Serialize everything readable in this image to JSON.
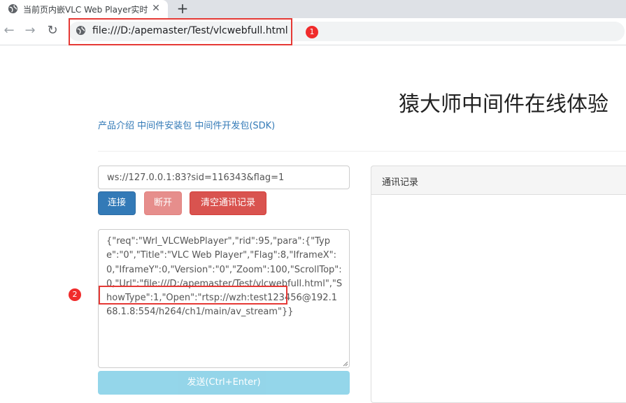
{
  "browser": {
    "tab_title": "当前页内嵌VLC Web Player实时",
    "tab_close": "✕",
    "new_tab": "+",
    "back": "←",
    "forward": "→",
    "reload": "↻",
    "url": "file:///D:/apemaster/Test/vlcwebfull.html"
  },
  "annotations": {
    "badge1": "1",
    "badge2": "2",
    "highlight_color": "#e53935"
  },
  "page": {
    "heading": "猿大师中间件在线体验",
    "links": [
      "产品介绍",
      "中间件安装包",
      "中间件开发包(SDK)"
    ],
    "ws_url": "ws://127.0.0.1:83?sid=116343&flag=1",
    "buttons": {
      "connect": "连接",
      "disconnect": "断开",
      "clear": "清空通讯记录",
      "send": "发送(Ctrl+Enter)"
    },
    "request_json": "{\"req\":\"Wrl_VLCWebPlayer\",\"rid\":95,\"para\":{\"Type\":\"0\",\"Title\":\"VLC Web Player\",\"Flag\":8,\"IframeX\":0,\"IframeY\":0,\"Version\":\"0\",\"Zoom\":100,\"ScrollTop\":0,\"Url\":\"file:///D:/apemaster/Test/vlcwebfull.html\",\"ShowType\":1,\"Open\":\"rtsp://wzh:test123456@192.168.1.8:554/h264/ch1/main/av_stream\"}}",
    "log_panel_title": "通讯记录"
  },
  "colors": {
    "primary": "#337ab7",
    "danger": "#d9534f",
    "info": "#5bc0de"
  }
}
